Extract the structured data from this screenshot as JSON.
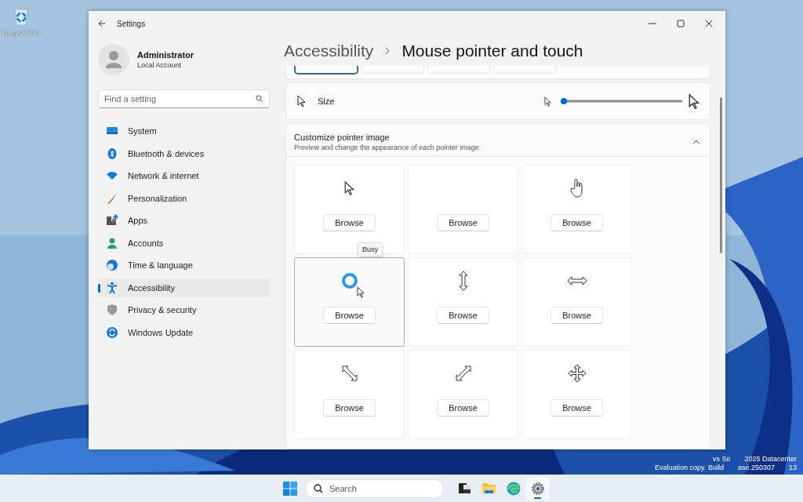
{
  "desktop": {
    "icons": [
      {
        "label": "Recycle Bin"
      }
    ]
  },
  "window": {
    "title": "Settings"
  },
  "user": {
    "name": "Administrator",
    "account": "Local Account"
  },
  "search": {
    "placeholder": "Find a setting"
  },
  "sidebar": {
    "items": [
      {
        "label": "System",
        "kind": "system",
        "selected": false
      },
      {
        "label": "Bluetooth & devices",
        "kind": "bluetooth",
        "selected": false
      },
      {
        "label": "Network & internet",
        "kind": "network",
        "selected": false
      },
      {
        "label": "Personalization",
        "kind": "brush",
        "selected": false
      },
      {
        "label": "Apps",
        "kind": "apps",
        "selected": false
      },
      {
        "label": "Accounts",
        "kind": "accounts",
        "selected": false
      },
      {
        "label": "Time & language",
        "kind": "time",
        "selected": false
      },
      {
        "label": "Accessibility",
        "kind": "accessibility",
        "selected": true
      },
      {
        "label": "Privacy & security",
        "kind": "shield",
        "selected": false
      },
      {
        "label": "Windows Update",
        "kind": "update",
        "selected": false
      }
    ]
  },
  "breadcrumb": [
    "Accessibility",
    "Mouse pointer and touch"
  ],
  "style_options": [
    {
      "selected": true
    },
    {
      "selected": false
    },
    {
      "selected": false
    },
    {
      "selected": false
    }
  ],
  "size_setting": {
    "label": "Size",
    "level": 0
  },
  "customize": {
    "title": "Customize pointer image",
    "description": "Preview and change the appearance of each pointer image",
    "expanded": true,
    "tooltip": "Busy",
    "pointers": [
      {
        "kind": "arrow",
        "button": "Browse",
        "highlighted": false
      },
      {
        "kind": "none",
        "button": "Browse",
        "highlighted": false
      },
      {
        "kind": "hand",
        "button": "Browse",
        "highlighted": false
      },
      {
        "kind": "busy",
        "button": "Browse",
        "highlighted": true
      },
      {
        "kind": "vertical",
        "button": "Browse",
        "highlighted": false
      },
      {
        "kind": "horizontal",
        "button": "Browse",
        "highlighted": false
      },
      {
        "kind": "diagonal-down",
        "button": "Browse",
        "highlighted": false
      },
      {
        "kind": "diagonal-up",
        "button": "Browse",
        "highlighted": false
      },
      {
        "kind": "move",
        "button": "Browse",
        "highlighted": false
      }
    ]
  },
  "build_info": [
    [
      "vs Se",
      "2025 Datacenter"
    ],
    [
      "Evaluation copy. Build",
      "ase.250307",
      "13"
    ]
  ],
  "taskbar": {
    "search_placeholder": "Search",
    "apps": [
      {
        "kind": "task-view",
        "selected": false
      },
      {
        "kind": "folder",
        "selected": false
      },
      {
        "kind": "browser",
        "selected": false
      },
      {
        "kind": "settings",
        "selected": true
      }
    ]
  }
}
